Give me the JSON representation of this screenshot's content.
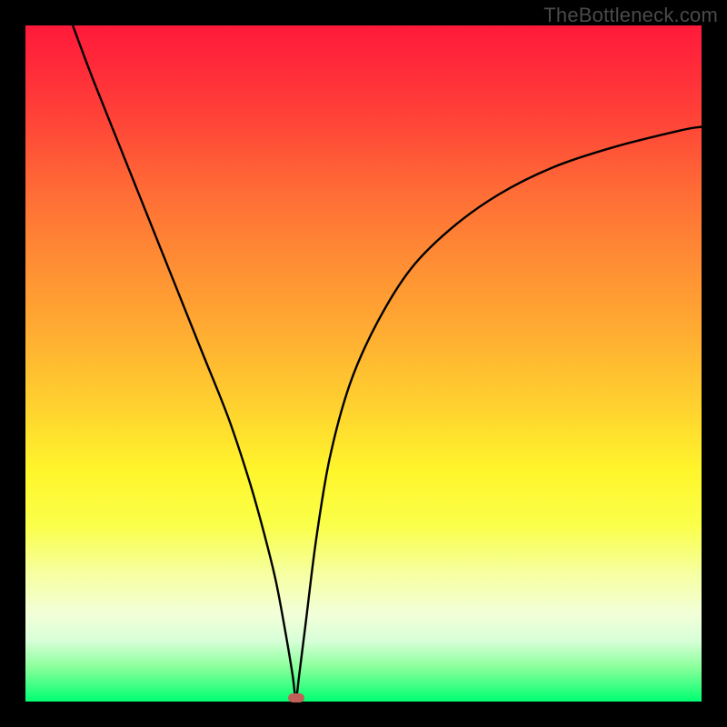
{
  "watermark": "TheBottleneck.com",
  "chart_data": {
    "type": "line",
    "title": "",
    "xlabel": "",
    "ylabel": "",
    "xlim": [
      0,
      100
    ],
    "ylim": [
      0,
      100
    ],
    "background_gradient": {
      "top_color": "#ff1a3a",
      "mid_color": "#fff62c",
      "bottom_color": "#00ff72",
      "meaning": "red high, green low (bottleneck severity scale)"
    },
    "series": [
      {
        "name": "bottleneck-curve",
        "color": "#000000",
        "x": [
          7,
          10,
          14,
          18,
          22,
          26,
          30,
          33,
          35,
          37,
          38.5,
          39.5,
          40,
          40.5,
          41.5,
          43,
          45,
          48,
          52,
          57,
          63,
          70,
          78,
          87,
          97,
          100
        ],
        "y": [
          100,
          92,
          82,
          72,
          62,
          52,
          42,
          33,
          26,
          18,
          10,
          4,
          0.5,
          4,
          12,
          24,
          36,
          47,
          56,
          64,
          70,
          75,
          79,
          82,
          84.5,
          85
        ]
      }
    ],
    "marker": {
      "name": "optimal-point",
      "x": 40,
      "y": 0.5,
      "color": "#c06058"
    }
  }
}
